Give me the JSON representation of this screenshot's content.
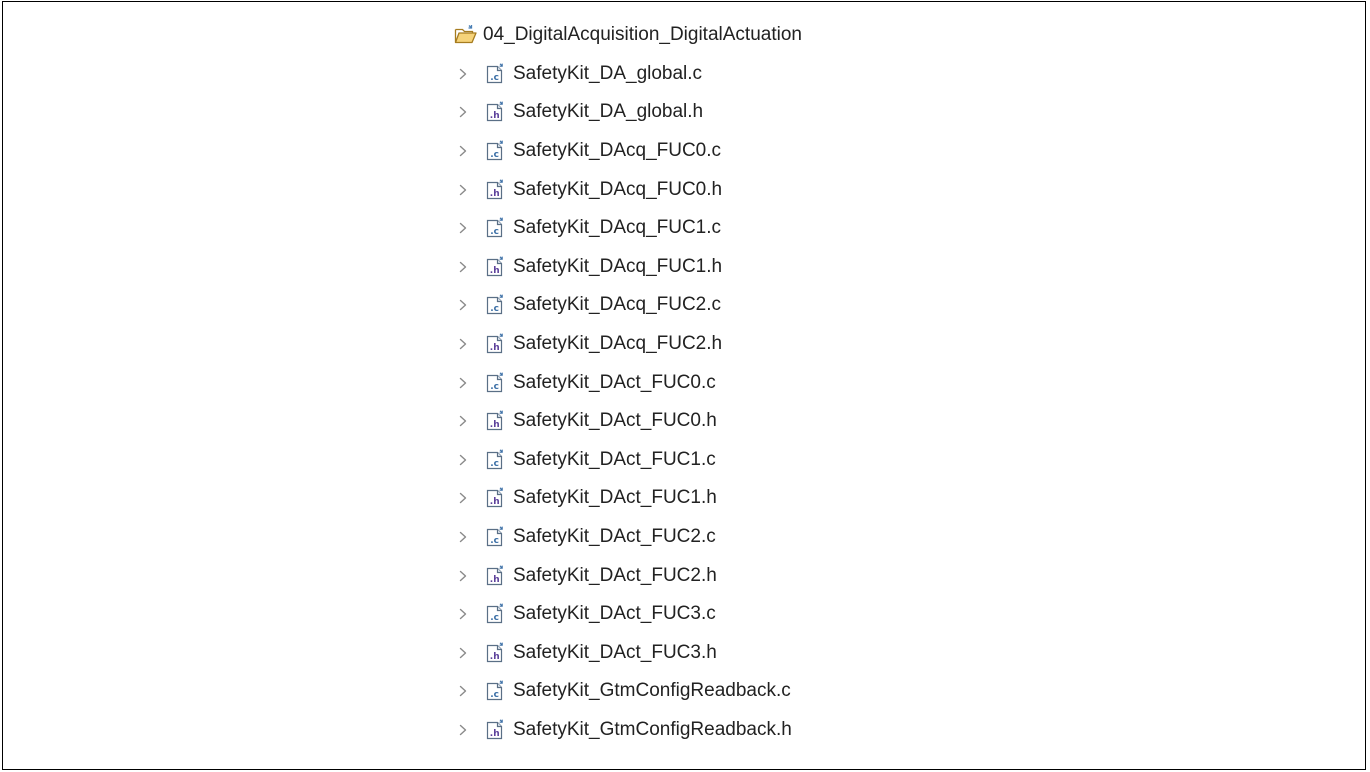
{
  "tree": {
    "root": {
      "label": "04_DigitalAcquisition_DigitalActuation",
      "icon": "open-folder-icon"
    },
    "files": [
      {
        "label": "SafetyKit_DA_global.c",
        "type": "c"
      },
      {
        "label": "SafetyKit_DA_global.h",
        "type": "h"
      },
      {
        "label": "SafetyKit_DAcq_FUC0.c",
        "type": "c"
      },
      {
        "label": "SafetyKit_DAcq_FUC0.h",
        "type": "h"
      },
      {
        "label": "SafetyKit_DAcq_FUC1.c",
        "type": "c"
      },
      {
        "label": "SafetyKit_DAcq_FUC1.h",
        "type": "h"
      },
      {
        "label": "SafetyKit_DAcq_FUC2.c",
        "type": "c"
      },
      {
        "label": "SafetyKit_DAcq_FUC2.h",
        "type": "h"
      },
      {
        "label": "SafetyKit_DAct_FUC0.c",
        "type": "c"
      },
      {
        "label": "SafetyKit_DAct_FUC0.h",
        "type": "h"
      },
      {
        "label": "SafetyKit_DAct_FUC1.c",
        "type": "c"
      },
      {
        "label": "SafetyKit_DAct_FUC1.h",
        "type": "h"
      },
      {
        "label": "SafetyKit_DAct_FUC2.c",
        "type": "c"
      },
      {
        "label": "SafetyKit_DAct_FUC2.h",
        "type": "h"
      },
      {
        "label": "SafetyKit_DAct_FUC3.c",
        "type": "c"
      },
      {
        "label": "SafetyKit_DAct_FUC3.h",
        "type": "h"
      },
      {
        "label": "SafetyKit_GtmConfigReadback.c",
        "type": "c"
      },
      {
        "label": "SafetyKit_GtmConfigReadback.h",
        "type": "h"
      }
    ]
  },
  "icons": {
    "c_file": "c-source-file-icon",
    "h_file": "h-header-file-icon",
    "expand": "chevron-right-icon"
  },
  "colors": {
    "chevron": "#8a8a8a",
    "c_icon_accent": "#4a7fb5",
    "h_icon_accent": "#6a4fa5",
    "folder": "#e8b84a"
  }
}
